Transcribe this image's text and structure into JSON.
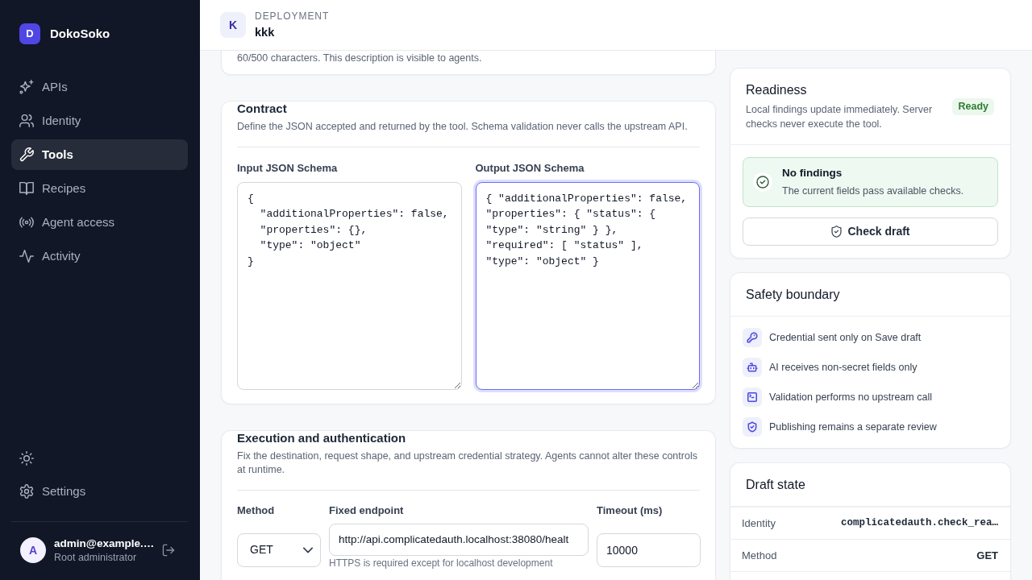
{
  "sidebar": {
    "brand": {
      "initial": "D",
      "name": "DokoSoko"
    },
    "nav": [
      {
        "label": "APIs",
        "selected": false
      },
      {
        "label": "Identity",
        "selected": false
      },
      {
        "label": "Tools",
        "selected": true
      },
      {
        "label": "Recipes",
        "selected": false
      },
      {
        "label": "Agent access",
        "selected": false
      },
      {
        "label": "Activity",
        "selected": false
      }
    ],
    "settings": {
      "label": "Settings"
    },
    "user": {
      "initial": "A",
      "email": "admin@example.…",
      "role": "Root administrator"
    }
  },
  "header": {
    "initial": "K",
    "eyebrow": "DEPLOYMENT",
    "title": "kkk"
  },
  "description_card": {
    "hint": "60/500 characters. This description is visible to agents."
  },
  "contract": {
    "title": "Contract",
    "description": "Define the JSON accepted and returned by the tool. Schema validation never calls the upstream API.",
    "schemas": [
      {
        "label": "Input JSON Schema",
        "value": "{\n  \"additionalProperties\": false,\n  \"properties\": {},\n  \"type\": \"object\"\n}",
        "focused": false
      },
      {
        "label": "Output JSON Schema",
        "value": "{ \"additionalProperties\": false, \"properties\": { \"status\": { \"type\": \"string\" } }, \"required\": [ \"status\" ], \"type\": \"object\" }",
        "focused": true
      }
    ]
  },
  "execution": {
    "title": "Execution and authentication",
    "description": "Fix the destination, request shape, and upstream credential strategy. Agents cannot alter these controls at runtime.",
    "method": {
      "label": "Method",
      "value": "GET"
    },
    "endpoint": {
      "label": "Fixed endpoint",
      "value": "http://api.complicatedauth.localhost:38080/healt",
      "hint": "HTTPS is required except for localhost development"
    },
    "timeout": {
      "label": "Timeout (ms)",
      "value": "10000"
    }
  },
  "readiness": {
    "title": "Readiness",
    "description": "Local findings update immediately. Server checks never execute the tool.",
    "badge": "Ready",
    "finding": {
      "title": "No findings",
      "detail": "The current fields pass available checks."
    },
    "button": "Check draft"
  },
  "safety": {
    "title": "Safety boundary",
    "items": [
      "Credential sent only on Save draft",
      "AI receives non-secret fields only",
      "Validation performs no upstream call",
      "Publishing remains a separate review"
    ]
  },
  "draft_state": {
    "title": "Draft state",
    "rows": [
      {
        "label": "Identity",
        "value": "complicatedauth.check_rea…",
        "kind": "code"
      },
      {
        "label": "Method",
        "value": "GET",
        "kind": "plain"
      }
    ]
  }
}
